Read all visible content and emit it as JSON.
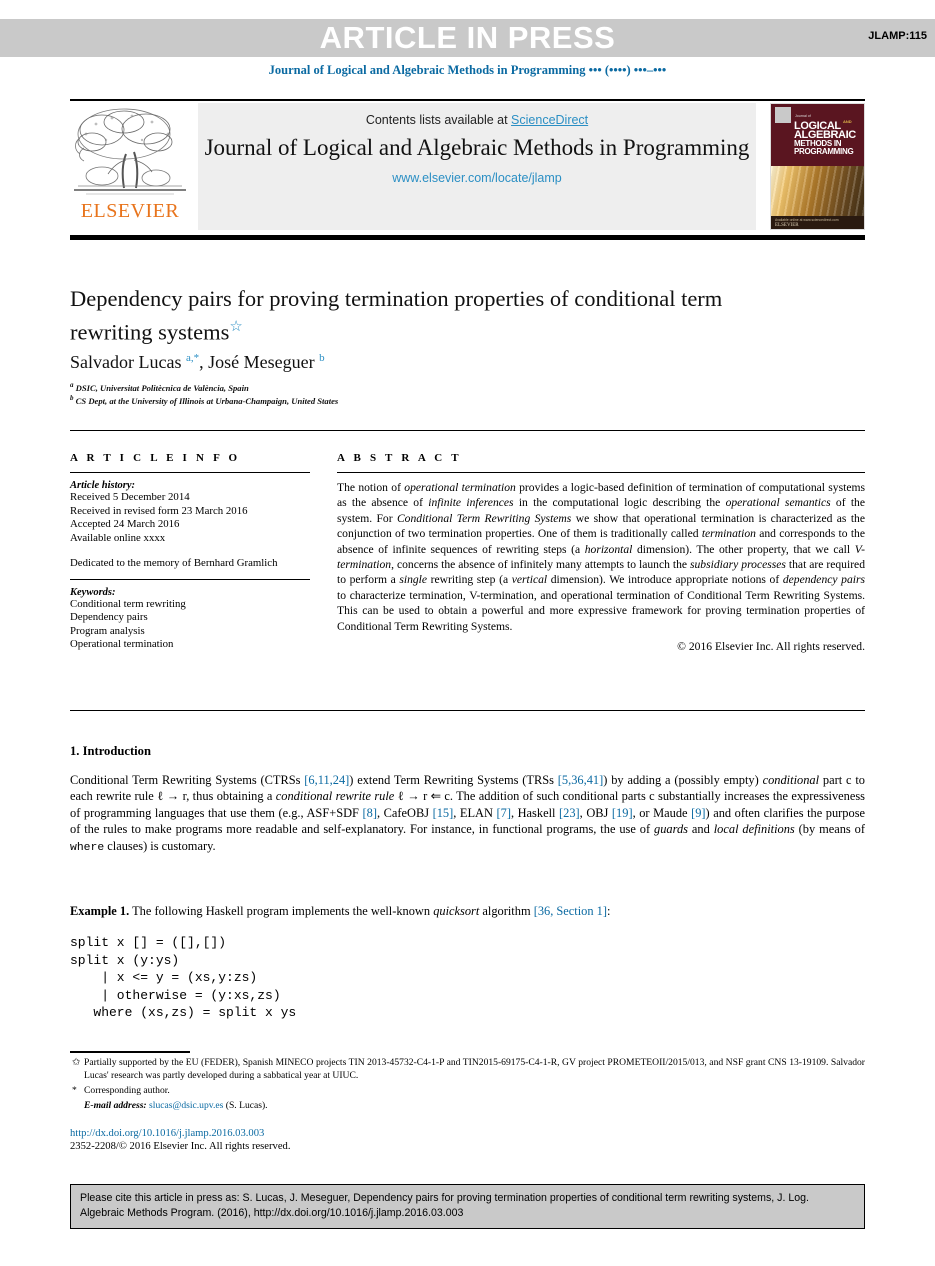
{
  "banner": {
    "article_in_press": "ARTICLE IN PRESS",
    "jlamp_number": "JLAMP:115"
  },
  "running_head": "Journal of Logical and Algebraic Methods in Programming ••• (••••) •••–•••",
  "masthead": {
    "contents_prefix": "Contents lists available at ",
    "sciencedirect": "ScienceDirect",
    "journal_title": "Journal of Logical and Algebraic Methods in Programming",
    "journal_url": "www.elsevier.com/locate/jlamp",
    "publisher": "ELSEVIER",
    "cover": {
      "subtitle": "Journal of",
      "line1": "LOGICAL",
      "and": "AND",
      "line2": "ALGEBRAIC",
      "line3": "METHODS IN",
      "line4": "PROGRAMMING",
      "bottom_text": "Available online at www.sciencedirect.com",
      "bottom_brand": "ELSEVIER"
    }
  },
  "article": {
    "title": "Dependency pairs for proving termination properties of conditional term rewriting systems",
    "title_mark": "☆",
    "authors_html": "Salvador Lucas <sup>a,*</sup>, José Meseguer <sup>b</sup>",
    "affiliation_a": "DSIC, Universitat Politècnica de València, Spain",
    "affiliation_b": "CS Dept, at the University of Illinois at Urbana-Champaign, United States"
  },
  "info": {
    "heading": "A R T I C L E    I N F O",
    "history_label": "Article history:",
    "history": [
      "Received 5 December 2014",
      "Received in revised form 23 March 2016",
      "Accepted 24 March 2016",
      "Available online xxxx"
    ],
    "dedication": "Dedicated to the memory of Bernhard Gramlich",
    "keywords_label": "Keywords:",
    "keywords": [
      "Conditional term rewriting",
      "Dependency pairs",
      "Program analysis",
      "Operational termination"
    ]
  },
  "abstract": {
    "heading": "A B S T R A C T",
    "text_html": "The notion of <i>operational termination</i> provides a logic-based definition of termination of computational systems as the absence of <i>infinite inferences</i> in the computational logic describing the <i>operational semantics</i> of the system. For <i>Conditional Term Rewriting Systems</i> we show that operational termination is characterized as the conjunction of two termination properties. One of them is traditionally called <i>termination</i> and corresponds to the absence of infinite sequences of rewriting steps (a <i>horizontal</i> dimension). The other property, that we call <i>V-termination</i>, concerns the absence of infinitely many attempts to launch the <i>subsidiary processes</i> that are required to perform a <i>single</i> rewriting step (a <i>vertical</i> dimension). We introduce appropriate notions of <i>dependency pairs</i> to characterize termination, V-termination, and operational termination of Conditional Term Rewriting Systems. This can be used to obtain a powerful and more expressive framework for proving termination properties of Conditional Term Rewriting Systems.",
    "copyright": "© 2016 Elsevier Inc. All rights reserved."
  },
  "body": {
    "section_title": "1. Introduction",
    "paragraph_1_html": "Conditional Term Rewriting Systems (CTRSs <span class=\"lnk\">[6,11,24]</span>) extend Term Rewriting Systems (TRSs <span class=\"lnk\">[5,36,41]</span>) by adding a (possibly empty) <i>conditional</i> part c to each rewrite rule ℓ → r, thus obtaining a <i>conditional rewrite rule</i> ℓ → r ⇐ c. The addition of such conditional parts c substantially increases the expressiveness of programming languages that use them (e.g., ASF+SDF <span class=\"lnk\">[8]</span>, CafeOBJ <span class=\"lnk\">[15]</span>, ELAN <span class=\"lnk\">[7]</span>, Haskell <span class=\"lnk\">[23]</span>, OBJ <span class=\"lnk\">[19]</span>, or Maude <span class=\"lnk\">[9]</span>) and often clarifies the purpose of the rules to make programs more readable and self-explanatory. For instance, in functional programs, the use of <i>guards</i> and <i>local definitions</i> (by means of <span style=\"font-family:'Liberation Mono',monospace;font-size:11.4px\">where</span> clauses) is customary.",
    "example_1_html": "<b>Example 1.</b> The following Haskell program implements the well-known <i>quicksort</i> algorithm <span class=\"lnk\">[36, Section 1]</span>:",
    "code": "split x [] = ([],[])\nsplit x (y:ys)\n    | x <= y = (xs,y:zs)\n    | otherwise = (y:xs,zs)\n   where (xs,zs) = split x ys"
  },
  "footnotes": {
    "funding_mark": "✩",
    "funding": "Partially supported by the EU (FEDER), Spanish MINECO projects TIN 2013-45732-C4-1-P and TIN2015-69175-C4-1-R, GV project PROMETEOII/2015/013, and NSF grant CNS 13-19109. Salvador Lucas' research was partly developed during a sabbatical year at UIUC.",
    "corresponding_mark": "*",
    "corresponding": "Corresponding author.",
    "email_label": "E-mail address:",
    "email": "slucas@dsic.upv.es",
    "email_suffix": "(S. Lucas).",
    "doi": "http://dx.doi.org/10.1016/j.jlamp.2016.03.003",
    "issn_copyright": "2352-2208/© 2016 Elsevier Inc. All rights reserved."
  },
  "cite_box": {
    "text": "Please cite this article in press as: S. Lucas, J. Meseguer, Dependency pairs for proving termination properties of conditional term rewriting systems, J. Log. Algebraic Methods Program. (2016), http://dx.doi.org/10.1016/j.jlamp.2016.03.003"
  },
  "colors": {
    "link_blue": "#0b6aa2",
    "sciencedirect_blue": "#2b8fc4",
    "elsevier_orange": "#e8741c",
    "banner_gray": "#c9c9c9",
    "masthead_gray": "#eeeeee"
  }
}
